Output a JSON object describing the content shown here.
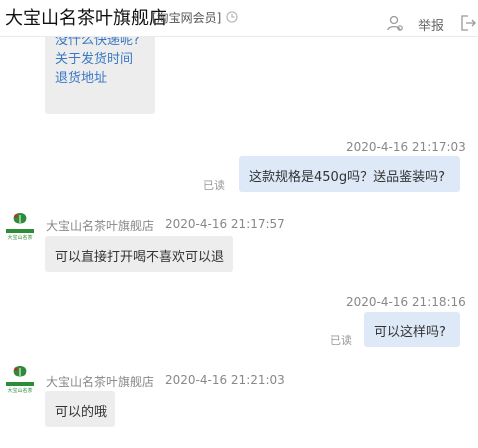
{
  "header": {
    "shop_name": "大宝山名茶叶旗舰店",
    "member_tag": "[淘宝网会员]",
    "report_label": "举报"
  },
  "top_links": [
    "没什么快递呢?",
    "关于发货时间",
    "退货地址"
  ],
  "messages": [
    {
      "side": "right",
      "time": "2020-4-16 21:17:03",
      "text": "这款规格是450g吗？送品鉴装吗?",
      "status": "已读"
    },
    {
      "side": "left",
      "sender": "大宝山名茶叶旗舰店",
      "time": "2020-4-16 21:17:57",
      "text": "可以直接打开喝不喜欢可以退"
    },
    {
      "side": "right",
      "time": "2020-4-16 21:18:16",
      "text": "可以这样吗?",
      "status": "已读"
    },
    {
      "side": "left",
      "sender": "大宝山名茶叶旗舰店",
      "time": "2020-4-16 21:21:03",
      "text": "可以的哦"
    }
  ],
  "avatar_brand": "大宝山名茶",
  "colors": {
    "self_bubble": "#dde9f7",
    "shop_bubble": "#ededed",
    "link": "#3a78c5",
    "avatar_green": "#2e8b3a",
    "avatar_red": "#d4202a"
  }
}
